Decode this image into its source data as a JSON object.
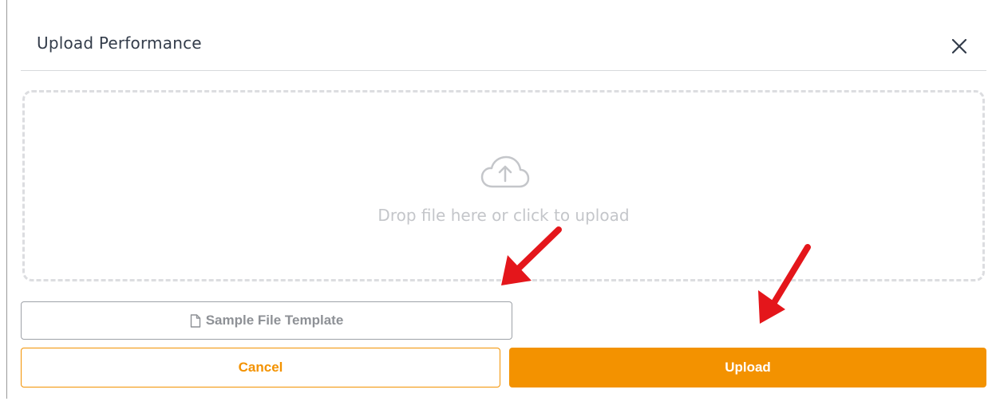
{
  "dialog": {
    "title": "Upload Performance",
    "close_icon": "close-icon"
  },
  "dropzone": {
    "icon": "cloud-upload-icon",
    "text": "Drop file here or click to upload"
  },
  "template_button": {
    "icon": "file-icon",
    "label": "Sample File Template"
  },
  "actions": {
    "cancel_label": "Cancel",
    "upload_label": "Upload"
  },
  "colors": {
    "accent": "#f39200",
    "annotation": "#e4161b",
    "title_text": "#333c4a",
    "muted_text": "#c4c6ca"
  },
  "annotations": {
    "arrow_icon": "red-arrow-icon",
    "count": 2
  }
}
